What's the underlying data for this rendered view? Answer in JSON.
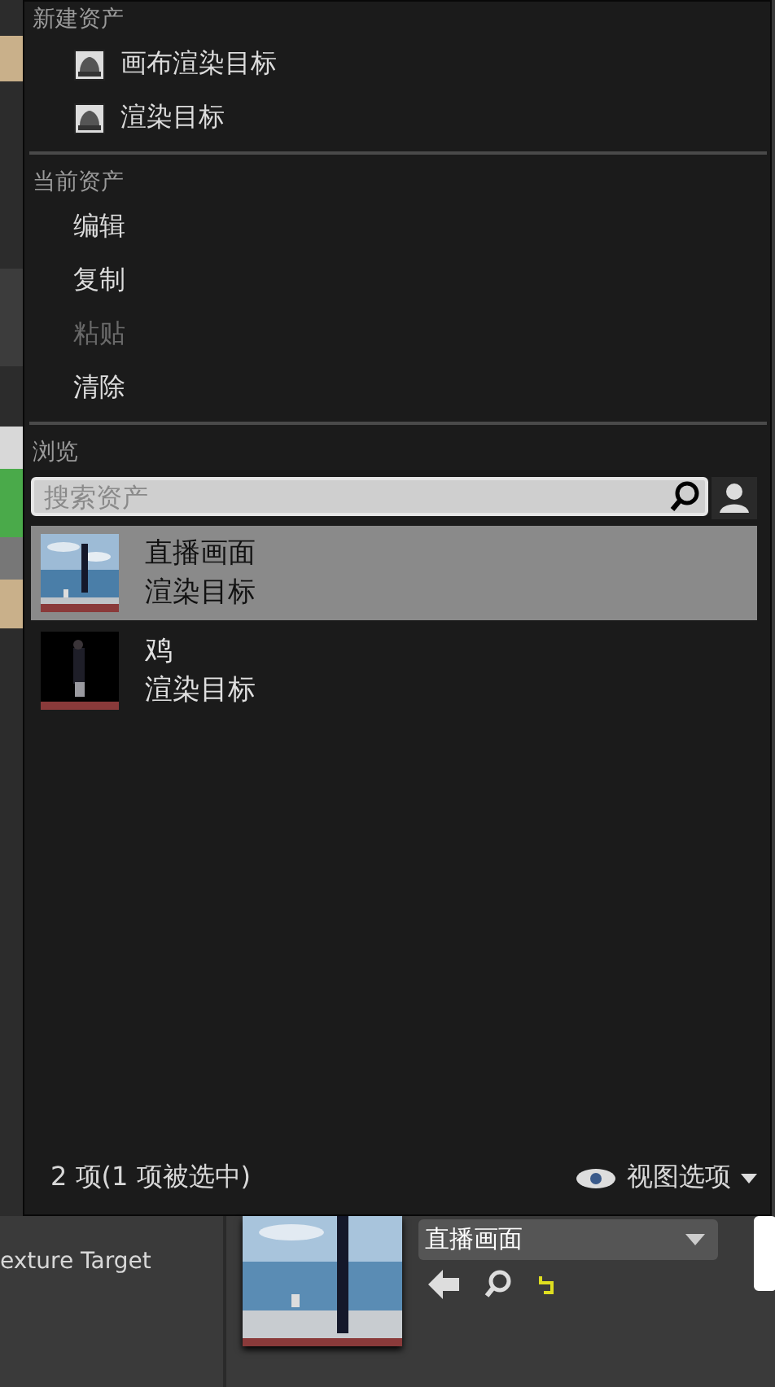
{
  "menu": {
    "sections": [
      {
        "title": "新建资产",
        "items": [
          {
            "label": "画布渲染目标",
            "kind": "asset",
            "disabled": false
          },
          {
            "label": "渲染目标",
            "kind": "asset",
            "disabled": false
          }
        ]
      },
      {
        "title": "当前资产",
        "items": [
          {
            "label": "编辑",
            "kind": "action",
            "disabled": false
          },
          {
            "label": "复制",
            "kind": "action",
            "disabled": false
          },
          {
            "label": "粘贴",
            "kind": "action",
            "disabled": true
          },
          {
            "label": "清除",
            "kind": "action",
            "disabled": false
          }
        ]
      }
    ],
    "browse": {
      "title": "浏览",
      "search": {
        "placeholder": "搜索资产"
      },
      "assets": [
        {
          "name": "直播画面",
          "type": "渲染目标",
          "selected": true
        },
        {
          "name": "鸡",
          "type": "渲染目标",
          "selected": false
        }
      ],
      "status": "2 项(1 项被选中)",
      "view_options": "视图选项"
    }
  },
  "property": {
    "label": "exture Target",
    "value": "直播画面"
  }
}
